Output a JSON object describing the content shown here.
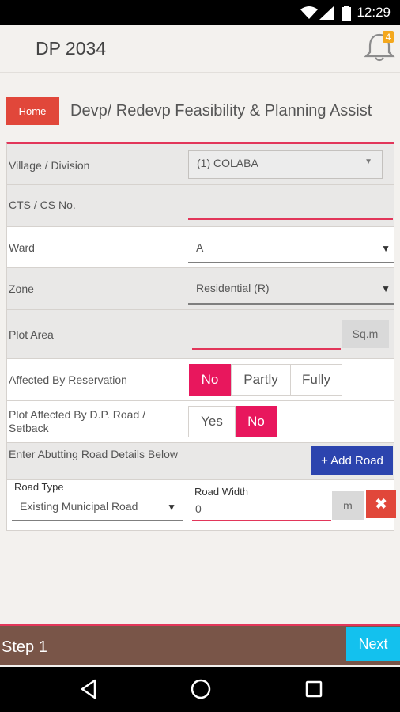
{
  "status_bar": {
    "time": "12:29",
    "icons": [
      "wifi-icon",
      "signal-icon",
      "battery-icon"
    ]
  },
  "app_bar": {
    "title": "DP 2034",
    "notification_count": "4"
  },
  "header": {
    "home_label": "Home",
    "heading": "Devp/ Redevp Feasibility & Planning Assist"
  },
  "form": {
    "village": {
      "label": "Village / Division",
      "value": "(1) COLABA"
    },
    "cts": {
      "label": "CTS / CS No.",
      "value": ""
    },
    "ward": {
      "label": "Ward",
      "value": "A"
    },
    "zone": {
      "label": "Zone",
      "value": "Residential (R)"
    },
    "plot_area": {
      "label": "Plot Area",
      "value": "",
      "unit": "Sq.m"
    },
    "reservation": {
      "label": "Affected By Reservation",
      "options": [
        "No",
        "Partly",
        "Fully"
      ],
      "selected": "No"
    },
    "dp_road": {
      "label_line1": "Plot Affected By D.P. Road /",
      "label_line2": "Setback",
      "options": [
        "Yes",
        "No"
      ],
      "selected": "No"
    },
    "abutting": {
      "label": "Enter Abutting Road Details Below",
      "add_button": "+ Add Road"
    },
    "road": {
      "type_label": "Road Type",
      "type_value": "Existing Municipal Road",
      "width_label": "Road Width",
      "width_value": "0",
      "unit": "m",
      "delete_symbol": "✖"
    }
  },
  "footer": {
    "step_label": "Step 1",
    "next_label": "Next"
  },
  "colors": {
    "accent_pink": "#e8175d",
    "home_red": "#e1473a",
    "add_blue": "#2c44ae",
    "footer_brown": "#795548",
    "next_cyan": "#13c1ee"
  }
}
